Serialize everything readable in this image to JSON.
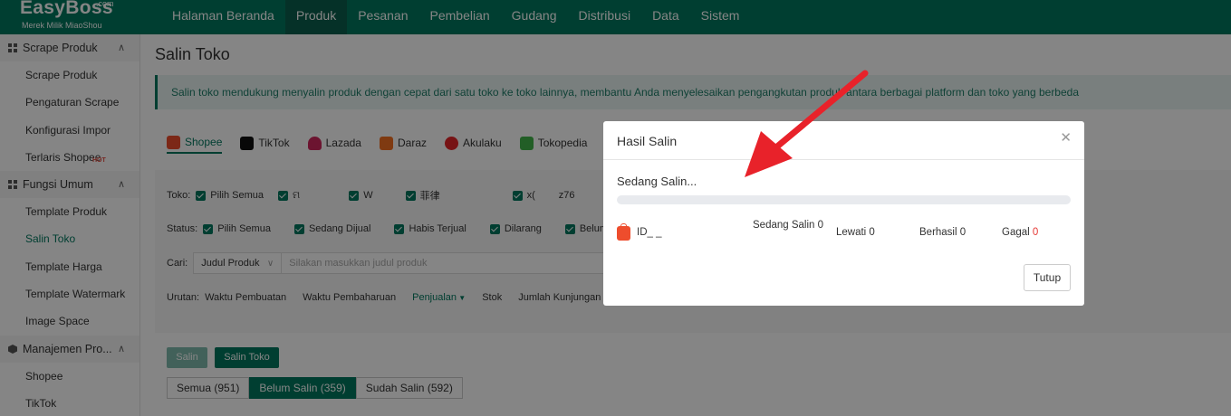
{
  "app": {
    "brand": "EasyBoss",
    "brand_suffix": ".com",
    "tagline": "Merek Milik MiaoShou"
  },
  "nav": [
    "Halaman Beranda",
    "Produk",
    "Pesanan",
    "Pembelian",
    "Gudang",
    "Distribusi",
    "Data",
    "Sistem"
  ],
  "sidebar": {
    "groups": [
      {
        "label": "Scrape Produk",
        "items": [
          "Scrape Produk",
          "Pengaturan Scrape",
          "Konfigurasi Impor",
          "Terlaris Shopee"
        ]
      },
      {
        "label": "Fungsi Umum",
        "items": [
          "Template Produk",
          "Salin Toko",
          "Template Harga",
          "Template Watermark",
          "Image Space"
        ]
      },
      {
        "label": "Manajemen Pro...",
        "items": [
          "Shopee",
          "TikTok"
        ]
      }
    ],
    "hot_badge": "HOT"
  },
  "page": {
    "title": "Salin Toko",
    "notice": "Salin toko mendukung menyalin produk dengan cepat dari satu toko ke toko lainnya, membantu Anda menyelesaikan pengangkutan produk antara berbagai platform dan toko yang berbeda",
    "platforms": [
      "Shopee",
      "TikTok",
      "Lazada",
      "Daraz",
      "Akulaku",
      "Tokopedia"
    ],
    "filters": {
      "toko_label": "Toko:",
      "toko_options": [
        "Pilih Semua",
        "ମ",
        "W",
        "菲律",
        "x(",
        "z76"
      ],
      "status_label": "Status:",
      "status_options": [
        "Pilih Semua",
        "Sedang Dijual",
        "Habis Terjual",
        "Dilarang",
        "Belum"
      ],
      "cari_label": "Cari:",
      "cari_select": "Judul Produk",
      "cari_placeholder": "Silakan masukkan judul produk",
      "urutan_label": "Urutan:",
      "urutan_options": [
        "Waktu Pembuatan",
        "Waktu Pembaharuan",
        "Penjualan",
        "Stok",
        "Jumlah Kunjungan"
      ]
    },
    "buttons": {
      "salin": "Salin",
      "salin_toko": "Salin Toko"
    },
    "tabs": [
      "Semua (951)",
      "Belum Salin (359)",
      "Sudah Salin (592)"
    ]
  },
  "modal": {
    "title": "Hasil Salin",
    "status": "Sedang Salin...",
    "progress": 0,
    "row": {
      "shop_id": "ID_ _",
      "sedang_salin": "Sedang Salin 0",
      "lewati": "Lewati 0",
      "berhasil": "Berhasil 0",
      "gagal_label": "Gagal",
      "gagal_value": "0"
    },
    "close_button": "Tutup"
  },
  "colors": {
    "primary": "#00775e",
    "shopee": "#ee4d2d",
    "error": "#e53935",
    "arrow": "#e8222a"
  }
}
